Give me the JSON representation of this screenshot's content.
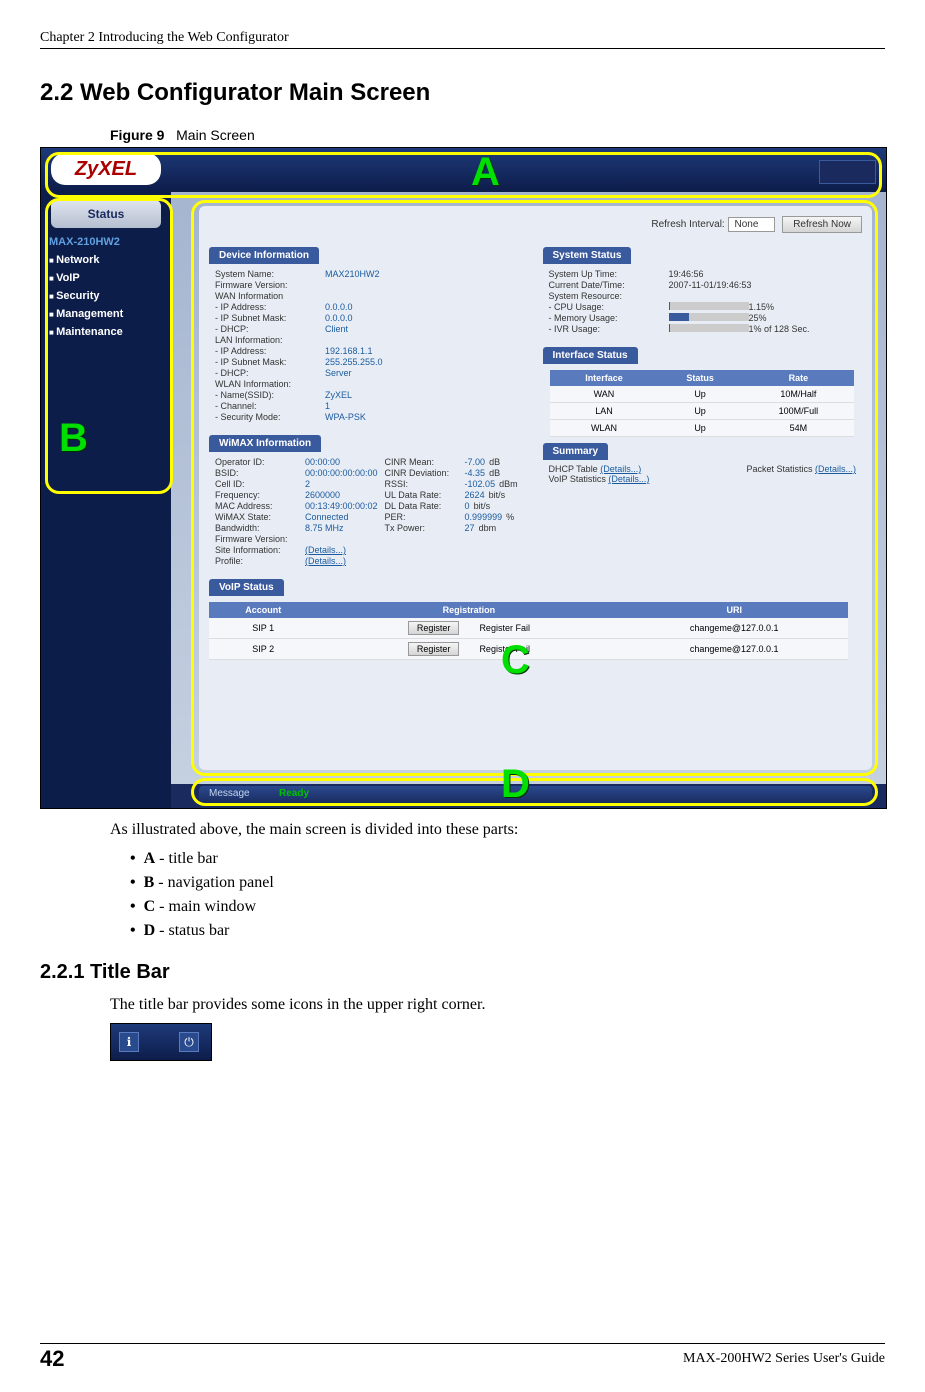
{
  "header": "Chapter 2 Introducing the Web Configurator",
  "section_heading": "2.2  Web Configurator Main Screen",
  "figure_label": "Figure 9",
  "figure_title": "Main Screen",
  "logo_text": "ZyXEL",
  "nav": {
    "status_btn": "Status",
    "model": "MAX-210HW2",
    "items": [
      "Network",
      "VoIP",
      "Security",
      "Management",
      "Maintenance"
    ]
  },
  "refresh": {
    "interval_label": "Refresh Interval:",
    "interval_value": "None",
    "refresh_now": "Refresh Now"
  },
  "device_info": {
    "title": "Device Information",
    "rows": [
      {
        "k": "System Name:",
        "v": "MAX210HW2"
      },
      {
        "k": "Firmware Version:",
        "v": ""
      },
      {
        "k": "WAN Information",
        "v": ""
      },
      {
        "k": "  - IP Address:",
        "v": "0.0.0.0"
      },
      {
        "k": "  - IP Subnet Mask:",
        "v": "0.0.0.0"
      },
      {
        "k": "  - DHCP:",
        "v": "Client"
      },
      {
        "k": "LAN Information:",
        "v": ""
      },
      {
        "k": "  - IP Address:",
        "v": "192.168.1.1"
      },
      {
        "k": "  - IP Subnet Mask:",
        "v": "255.255.255.0"
      },
      {
        "k": "  - DHCP:",
        "v": "Server"
      },
      {
        "k": "WLAN Information:",
        "v": ""
      },
      {
        "k": "  - Name(SSID):",
        "v": "ZyXEL"
      },
      {
        "k": "  - Channel:",
        "v": "1"
      },
      {
        "k": "  - Security Mode:",
        "v": "WPA-PSK"
      }
    ]
  },
  "wimax_info": {
    "title": "WiMAX Information",
    "left": [
      {
        "k": "Operator ID:",
        "v": "00:00:00"
      },
      {
        "k": "BSID:",
        "v": "00:00:00:00:00:00"
      },
      {
        "k": "Cell ID:",
        "v": "2"
      },
      {
        "k": "Frequency:",
        "v": "2600000"
      },
      {
        "k": "MAC Address:",
        "v": "00:13:49:00:00:02"
      },
      {
        "k": "WiMAX State:",
        "v": "Connected"
      },
      {
        "k": "Bandwidth:",
        "v": "8.75 MHz"
      },
      {
        "k": "Firmware Version:",
        "v": ""
      },
      {
        "k": "Site Information:",
        "v": "(Details...)"
      },
      {
        "k": "Profile:",
        "v": "(Details...)"
      }
    ],
    "right": [
      {
        "k": "CINR Mean:",
        "v": "-7.00",
        "u": "dB"
      },
      {
        "k": "CINR Deviation:",
        "v": "-4.35",
        "u": "dB"
      },
      {
        "k": "RSSI:",
        "v": "-102.05",
        "u": "dBm"
      },
      {
        "k": "UL Data Rate:",
        "v": "2624",
        "u": "bit/s"
      },
      {
        "k": "DL Data Rate:",
        "v": "0",
        "u": "bit/s"
      },
      {
        "k": "PER:",
        "v": "0.999999",
        "u": "%"
      },
      {
        "k": "Tx Power:",
        "v": "27",
        "u": "dbm"
      }
    ]
  },
  "system_status": {
    "title": "System Status",
    "rows": [
      {
        "k": "System Up Time:",
        "v": "19:46:56"
      },
      {
        "k": "Current Date/Time:",
        "v": "2007-11-01/19:46:53"
      },
      {
        "k": "System Resource:",
        "v": ""
      },
      {
        "k": "  - CPU Usage:",
        "v": "1.15%",
        "bar": 2
      },
      {
        "k": "  - Memory Usage:",
        "v": "25%",
        "bar": 25
      },
      {
        "k": "  - IVR Usage:",
        "v": "1% of 128 Sec.",
        "bar": 1
      }
    ]
  },
  "interface_status": {
    "title": "Interface Status",
    "headers": [
      "Interface",
      "Status",
      "Rate"
    ],
    "rows": [
      [
        "WAN",
        "Up",
        "10M/Half"
      ],
      [
        "LAN",
        "Up",
        "100M/Full"
      ],
      [
        "WLAN",
        "Up",
        "54M"
      ]
    ]
  },
  "summary": {
    "title": "Summary",
    "dhcp": "DHCP Table",
    "dhcp_link": "(Details...)",
    "packet": "Packet Statistics",
    "packet_link": "(Details...)",
    "voip": "VoIP Statistics",
    "voip_link": "(Details...)"
  },
  "voip_status": {
    "title": "VoIP Status",
    "headers": [
      "Account",
      "Registration",
      "URI"
    ],
    "rows": [
      {
        "acct": "SIP 1",
        "btn": "Register",
        "reg": "Register Fail",
        "uri": "changeme@127.0.0.1"
      },
      {
        "acct": "SIP 2",
        "btn": "Register",
        "reg": "Register Fail",
        "uri": "changeme@127.0.0.1"
      }
    ]
  },
  "status_bar": {
    "label": "Message",
    "value": "Ready"
  },
  "overlay": {
    "a": "A",
    "b": "B",
    "c": "C",
    "d": "D"
  },
  "intro_text": "As illustrated above, the main screen is divided into these parts:",
  "bullets": [
    {
      "l": "A",
      "t": " - title bar"
    },
    {
      "l": "B",
      "t": " - navigation panel"
    },
    {
      "l": "C",
      "t": " - main window"
    },
    {
      "l": "D",
      "t": " - status bar"
    }
  ],
  "subsection_heading": "2.2.1  Title Bar",
  "subsection_text": "The title bar provides some icons in the upper right corner.",
  "footer": {
    "page": "42",
    "text": "MAX-200HW2 Series User's Guide"
  }
}
